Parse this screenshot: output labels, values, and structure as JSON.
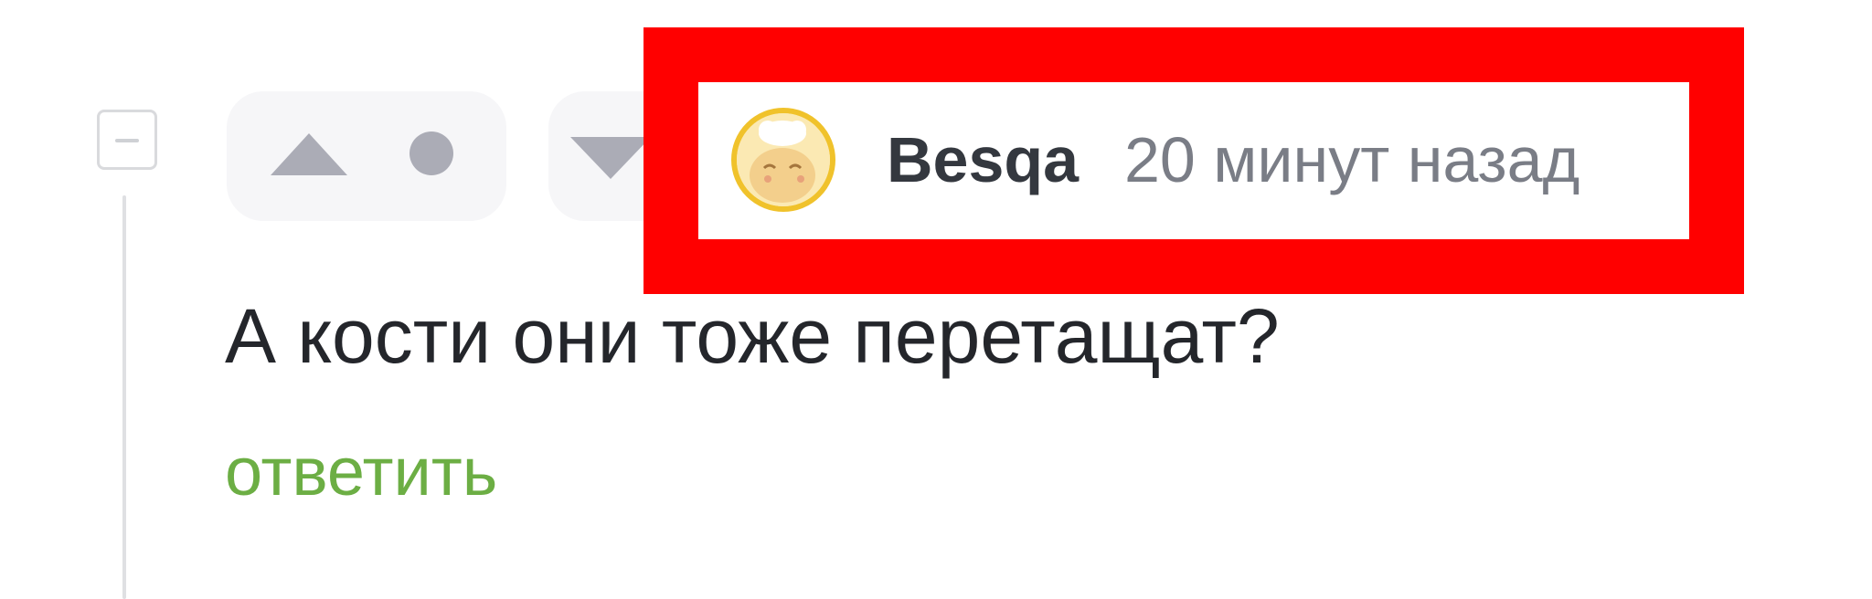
{
  "comment": {
    "author": "Besqa",
    "timestamp": "20 минут назад",
    "text": "А кости они тоже перетащат?",
    "reply_label": "ответить",
    "avatar_icon": "chef-avatar-icon"
  },
  "votes": {
    "upvote_icon": "arrow-up-icon",
    "downvote_icon": "arrow-down-icon",
    "score_icon": "dot-icon"
  },
  "colors": {
    "highlight": "#ff0000",
    "reply_link": "#6cae44",
    "avatar_ring": "#f0c22b"
  }
}
